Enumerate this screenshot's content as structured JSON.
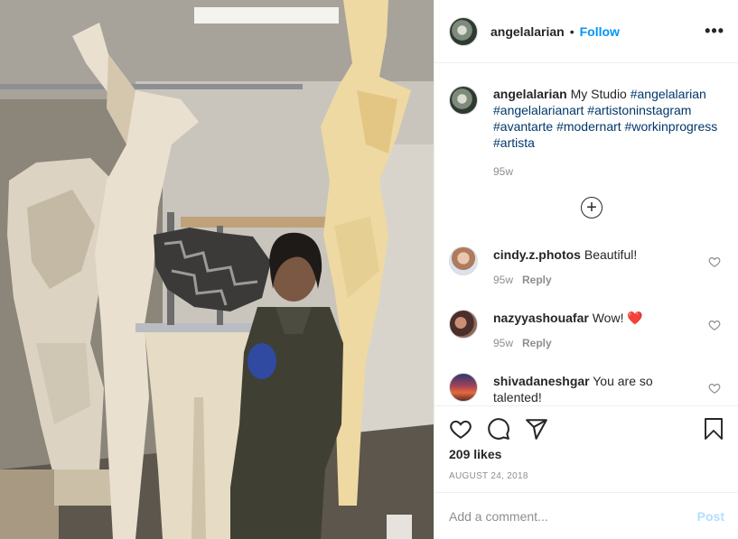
{
  "post": {
    "author": "angelalarian",
    "follow_label": "Follow",
    "dot": "•",
    "more_label": "•••",
    "caption_text": " My Studio ",
    "caption_tags": [
      "#angelalarian",
      "#angelalarianart",
      "#artistoninstagram",
      "#avantarte",
      "#modernart",
      "#workinprogress",
      "#artista"
    ],
    "caption_age": "95w",
    "load_more_label": "+",
    "comments": [
      {
        "user": "cindy.z.photos",
        "text": " Beautiful!",
        "age": "95w",
        "reply": "Reply"
      },
      {
        "user": "nazyyashouafar",
        "text": " Wow! ❤️",
        "age": "95w",
        "reply": "Reply"
      },
      {
        "user": "shivadaneshgar",
        "text": " You are so talented!",
        "age": "",
        "reply": ""
      }
    ],
    "likes": "209 likes",
    "date": "AUGUST 24, 2018",
    "comment_placeholder": "Add a comment...",
    "post_label": "Post"
  },
  "icons": {
    "like": "heart-icon",
    "comment": "comment-icon",
    "share": "paper-plane-icon",
    "save": "bookmark-icon",
    "comment_like": "small-heart-icon",
    "more": "more-horizontal-icon",
    "load_more": "plus-circle-icon"
  },
  "colors": {
    "link_blue": "#0095f6",
    "hashtag": "#00376b",
    "muted": "#8e8e8e",
    "border": "#efefef",
    "post_disabled": "#b2dffc"
  }
}
